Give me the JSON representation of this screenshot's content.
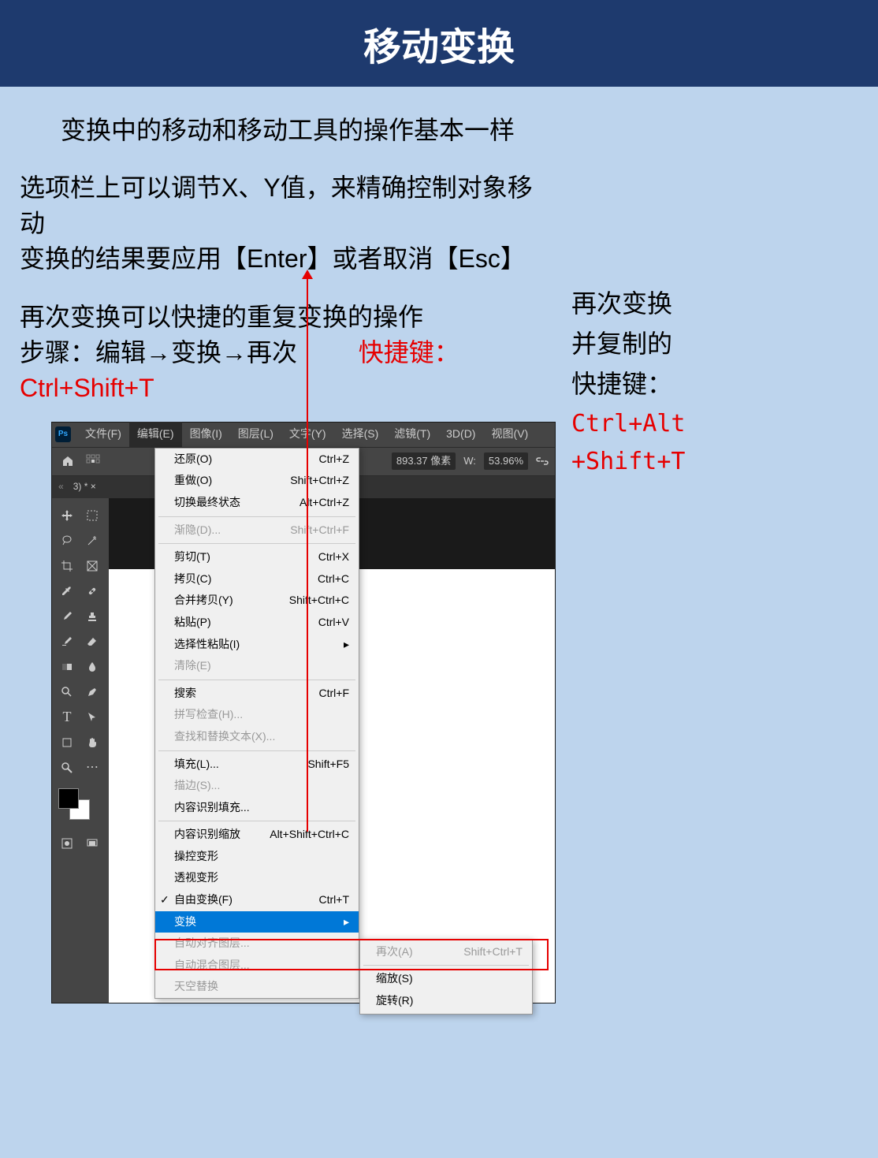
{
  "header": {
    "title": "移动变换"
  },
  "intro": "变换中的移动和移动工具的操作基本一样",
  "para1_line1": "选项栏上可以调节X、Y值，来精确控制对象移动",
  "para1_line2": "变换的结果要应用【Enter】或者取消【Esc】",
  "para2_line1": "再次变换可以快捷的重复变换的操作",
  "para2_line2a": "步骤：编辑→变换→再次",
  "para2_line2b": "快捷键：Ctrl+Shift+T",
  "sidebar": {
    "line1": "再次变换",
    "line2": "并复制的",
    "line3": "快捷键：",
    "shortcut1": "Ctrl+Alt",
    "shortcut2": "+Shift+T"
  },
  "ps": {
    "logo": "Ps",
    "menus": [
      "文件(F)",
      "编辑(E)",
      "图像(I)",
      "图层(L)",
      "文字(Y)",
      "选择(S)",
      "滤镜(T)",
      "3D(D)",
      "视图(V)"
    ],
    "options": {
      "coord": "893.37 像素",
      "w_label": "W:",
      "w_value": "53.96%"
    },
    "tab": "3) * ×",
    "dropdown": [
      {
        "label": "还原(O)",
        "shortcut": "Ctrl+Z"
      },
      {
        "label": "重做(O)",
        "shortcut": "Shift+Ctrl+Z"
      },
      {
        "label": "切换最终状态",
        "shortcut": "Alt+Ctrl+Z"
      },
      {
        "sep": true
      },
      {
        "label": "渐隐(D)...",
        "shortcut": "Shift+Ctrl+F",
        "disabled": true
      },
      {
        "sep": true
      },
      {
        "label": "剪切(T)",
        "shortcut": "Ctrl+X"
      },
      {
        "label": "拷贝(C)",
        "shortcut": "Ctrl+C"
      },
      {
        "label": "合并拷贝(Y)",
        "shortcut": "Shift+Ctrl+C"
      },
      {
        "label": "粘贴(P)",
        "shortcut": "Ctrl+V"
      },
      {
        "label": "选择性粘贴(I)",
        "arrow": true
      },
      {
        "label": "清除(E)",
        "disabled": true
      },
      {
        "sep": true
      },
      {
        "label": "搜索",
        "shortcut": "Ctrl+F"
      },
      {
        "label": "拼写检查(H)...",
        "disabled": true
      },
      {
        "label": "查找和替换文本(X)...",
        "disabled": true
      },
      {
        "sep": true
      },
      {
        "label": "填充(L)...",
        "shortcut": "Shift+F5"
      },
      {
        "label": "描边(S)...",
        "disabled": true
      },
      {
        "label": "内容识别填充..."
      },
      {
        "sep": true
      },
      {
        "label": "内容识别缩放",
        "shortcut": "Alt+Shift+Ctrl+C"
      },
      {
        "label": "操控变形"
      },
      {
        "label": "透视变形"
      },
      {
        "label": "自由变换(F)",
        "shortcut": "Ctrl+T",
        "checked": true
      },
      {
        "label": "变换",
        "arrow": true,
        "highlighted": true
      },
      {
        "label": "自动对齐图层...",
        "disabled": true
      },
      {
        "label": "自动混合图层...",
        "disabled": true
      },
      {
        "label": "天空替换",
        "disabled": true
      }
    ],
    "submenu": [
      {
        "label": "再次(A)",
        "shortcut": "Shift+Ctrl+T",
        "disabled": true
      },
      {
        "sep": true
      },
      {
        "label": "缩放(S)"
      },
      {
        "label": "旋转(R)"
      }
    ]
  }
}
